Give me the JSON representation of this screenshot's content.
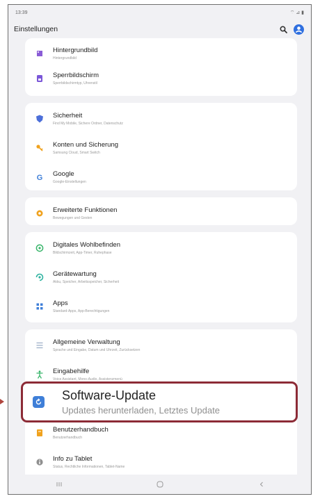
{
  "status_bar": {
    "time": "13:39",
    "indicators": "⌔ ⊿ ▮"
  },
  "app_bar": {
    "title": "Einstellungen",
    "search_icon": "search-icon",
    "profile_icon": "profile-icon"
  },
  "items": [
    {
      "title": "Hintergrundbild",
      "subtitle": "Hintergrundbild",
      "icon": "wallpaper-icon",
      "color": "#8a5cd6"
    },
    {
      "title": "Sperrbildschirm",
      "subtitle": "Sperrbildschirmtyp, Uhrenstil",
      "icon": "lockscreen-icon",
      "color": "#7b57d8"
    },
    {
      "title": "Sicherheit",
      "subtitle": "Find My Mobile, Sichere Ordner, Datenschutz",
      "icon": "shield-icon",
      "color": "#4c6fd9"
    },
    {
      "title": "Konten und Sicherung",
      "subtitle": "Samsung Cloud, Smart Switch",
      "icon": "key-icon",
      "color": "#f0a21e"
    },
    {
      "title": "Google",
      "subtitle": "Google-Einstellungen",
      "icon": "google-icon",
      "color": "#3f7fd8"
    },
    {
      "title": "Erweiterte Funktionen",
      "subtitle": "Bewegungen und Gesten",
      "icon": "advanced-features-icon",
      "color": "#f0a21e"
    },
    {
      "title": "Digitales Wohlbefinden",
      "subtitle": "Bildschirmzeit, App-Timer, Ruhephase",
      "icon": "wellbeing-icon",
      "color": "#38b56a"
    },
    {
      "title": "Gerätewartung",
      "subtitle": "Akku, Speicher, Arbeitsspeicher, Sicherheit",
      "icon": "device-care-icon",
      "color": "#2fb3a0"
    },
    {
      "title": "Apps",
      "subtitle": "Standard-Apps, App-Berechtigungen",
      "icon": "apps-icon",
      "color": "#3f7fd8"
    },
    {
      "title": "Allgemeine Verwaltung",
      "subtitle": "Sprache und Eingabe, Datum und Uhrzeit, Zurücksetzen",
      "icon": "general-management-icon",
      "color": "#9fb0c8"
    },
    {
      "title": "Eingabehilfe",
      "subtitle": "Voice Assistant, Mono-Audio, Assistenzmenü",
      "icon": "accessibility-icon",
      "color": "#38b56a"
    },
    {
      "title": "Benutzerhandbuch",
      "subtitle": "Benutzerhandbuch",
      "icon": "manual-icon",
      "color": "#f0a21e"
    },
    {
      "title": "Info zu Tablet",
      "subtitle": "Status, Rechtliche Informationen, Tablet-Name",
      "icon": "info-icon",
      "color": "#8f8f8f"
    }
  ],
  "highlighted_item": {
    "title": "Software-Update",
    "subtitle": "Updates herunterladen, Letztes Update",
    "icon": "software-update-icon",
    "color": "#3f7fd8",
    "frame_color": "#8c2b36"
  },
  "nav_bar": {
    "recents_icon": "recents-icon",
    "home_icon": "home-icon",
    "back_icon": "back-icon"
  }
}
